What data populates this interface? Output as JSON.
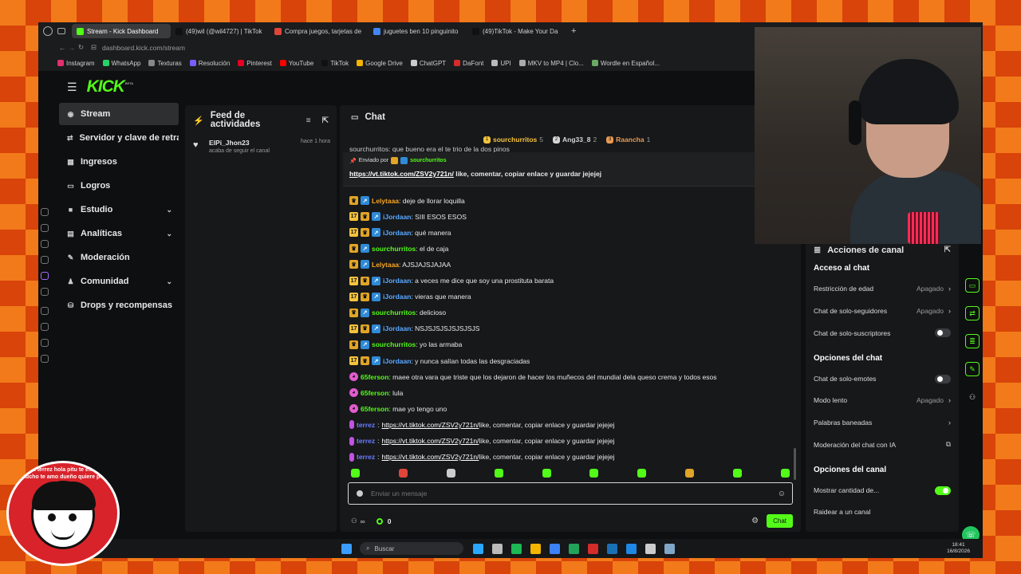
{
  "browser": {
    "tabs": [
      {
        "label": "Stream - Kick Dashboard",
        "active": true,
        "color": "#53fc18"
      },
      {
        "label": "(49)wil (@wil4727) | TikTok",
        "active": false,
        "color": "#111111"
      },
      {
        "label": "Compra juegos, tarjetas de",
        "active": false,
        "color": "#e0453a"
      },
      {
        "label": "juguetes ben 10 pinguinito",
        "active": false,
        "color": "#4285f4"
      },
      {
        "label": "(49)TikTok - Make Your Da",
        "active": false,
        "color": "#111111"
      }
    ],
    "new_tab": "+",
    "url": "dashboard.kick.com/stream",
    "bookmarks": [
      {
        "label": "Instagram",
        "color": "#e1306c"
      },
      {
        "label": "WhatsApp",
        "color": "#25d366"
      },
      {
        "label": "Texturas",
        "color": "#888888"
      },
      {
        "label": "Resolución",
        "color": "#7b5cff"
      },
      {
        "label": "Pinterest",
        "color": "#e60023"
      },
      {
        "label": "YouTube",
        "color": "#ff0000"
      },
      {
        "label": "TikTok",
        "color": "#111111"
      },
      {
        "label": "Google Drive",
        "color": "#f4b400"
      },
      {
        "label": "ChatGPT",
        "color": "#cccccc"
      },
      {
        "label": "DaFont",
        "color": "#d42b2b"
      },
      {
        "label": "UPI",
        "color": "#bbbbbb"
      },
      {
        "label": "MKV to MP4 | Clo...",
        "color": "#aaaaaa"
      },
      {
        "label": "Wordle en Español...",
        "color": "#6aaa64"
      }
    ]
  },
  "app": {
    "logo": "KICK",
    "logo_beta": "BETA",
    "nav": [
      {
        "label": "Stream",
        "icon": "stream-icon",
        "glyph": "((·))",
        "active": true,
        "expand": false
      },
      {
        "label": "Servidor y clave de retransmisión",
        "icon": "server-icon",
        "glyph": "⇄",
        "active": false,
        "expand": false
      },
      {
        "label": "Ingresos",
        "icon": "revenue-icon",
        "glyph": "▦",
        "active": false,
        "expand": false
      },
      {
        "label": "Logros",
        "icon": "achievements-icon",
        "glyph": "▭",
        "active": false,
        "expand": false
      },
      {
        "label": "Estudio",
        "icon": "studio-icon",
        "glyph": "■",
        "active": false,
        "expand": true
      },
      {
        "label": "Analíticas",
        "icon": "analytics-icon",
        "glyph": "▤",
        "active": false,
        "expand": true
      },
      {
        "label": "Moderación",
        "icon": "moderation-icon",
        "glyph": "✎",
        "active": false,
        "expand": false
      },
      {
        "label": "Comunidad",
        "icon": "community-icon",
        "glyph": "♟",
        "active": false,
        "expand": true
      },
      {
        "label": "Drops y recompensas",
        "icon": "drops-icon",
        "glyph": "⛁",
        "active": false,
        "expand": false
      }
    ],
    "feed": {
      "title": "Feed de actividades",
      "items": [
        {
          "user": "ElPi_Jhon23",
          "action": "acaba de seguir el canal",
          "time": "hace 1 hora"
        }
      ]
    },
    "chat": {
      "title": "Chat",
      "top_gifters": [
        {
          "rank": "1",
          "name": "sourchurritos",
          "count": "5",
          "color": "#f5c33b"
        },
        {
          "rank": "2",
          "name": "Ang33_8",
          "count": "2",
          "color": "#d6d6d6"
        },
        {
          "rank": "3",
          "name": "Raancha",
          "count": "1",
          "color": "#e89a53"
        }
      ],
      "pinned_partial": "sourchurritos: que bueno era el te trio de la dos pinos",
      "pinned": {
        "label": "Enviado por",
        "user": "sourchurritos",
        "link": "https://vt.tiktok.com/ZSV2y721n/",
        "text": " like, comentar, copiar enlace y guardar jejejej"
      },
      "messages": [
        {
          "badges": [
            "crown",
            "blue"
          ],
          "user": "Lelytaaa",
          "color": "#f5a623",
          "text": ": deje de llorar loquilla",
          "link": ""
        },
        {
          "badges": [
            "17",
            "crown",
            "blue"
          ],
          "user": "iJordaan",
          "color": "#5aa9ff",
          "text": ": SIII ESOS ESOS",
          "link": ""
        },
        {
          "badges": [
            "17",
            "crown",
            "blue"
          ],
          "user": "iJordaan",
          "color": "#5aa9ff",
          "text": ": qué manera",
          "link": ""
        },
        {
          "badges": [
            "crown",
            "blue"
          ],
          "user": "sourchurritos",
          "color": "#53fc18",
          "text": ": el de caja",
          "link": ""
        },
        {
          "badges": [
            "crown",
            "blue"
          ],
          "user": "Lelytaaa",
          "color": "#f5a623",
          "text": ": AJSJAJSJAJAA",
          "link": ""
        },
        {
          "badges": [
            "17",
            "crown",
            "blue"
          ],
          "user": "iJordaan",
          "color": "#5aa9ff",
          "text": ": a veces me dice que soy una prostituta barata",
          "link": ""
        },
        {
          "badges": [
            "17",
            "crown",
            "blue"
          ],
          "user": "iJordaan",
          "color": "#5aa9ff",
          "text": ": vieras que manera",
          "link": ""
        },
        {
          "badges": [
            "crown",
            "blue"
          ],
          "user": "sourchurritos",
          "color": "#53fc18",
          "text": ": delicioso",
          "link": ""
        },
        {
          "badges": [
            "17",
            "crown",
            "blue"
          ],
          "user": "iJordaan",
          "color": "#5aa9ff",
          "text": ": NSJSJSJSJSJSJSJS",
          "link": ""
        },
        {
          "badges": [
            "crown",
            "blue"
          ],
          "user": "sourchurritos",
          "color": "#53fc18",
          "text": ": yo las armaba",
          "link": ""
        },
        {
          "badges": [
            "17",
            "crown",
            "blue"
          ],
          "user": "iJordaan",
          "color": "#5aa9ff",
          "text": ": y nunca salían todas las desgraciadas",
          "link": ""
        },
        {
          "badges": [
            "pink"
          ],
          "user": "65ferson",
          "color": "#53fc18",
          "text": ": maee otra vara que triste que los dejaron de hacer los muñecos del mundial dela queso crema y todos esos",
          "link": ""
        },
        {
          "badges": [
            "pink"
          ],
          "user": "65ferson",
          "color": "#53fc18",
          "text": ": lula",
          "link": ""
        },
        {
          "badges": [
            "pink"
          ],
          "user": "65ferson",
          "color": "#53fc18",
          "text": ": mae yo tengo uno",
          "link": ""
        },
        {
          "badges": [
            "mic"
          ],
          "user": "terrez",
          "color": "#6a7dff",
          "text": " like, comentar, copiar enlace y guardar jejejej",
          "link": "https://vt.tiktok.com/ZSV2y721n/"
        },
        {
          "badges": [
            "mic"
          ],
          "user": "terrez",
          "color": "#6a7dff",
          "text": " like, comentar, copiar enlace y guardar jejejej",
          "link": "https://vt.tiktok.com/ZSV2y721n/"
        },
        {
          "badges": [
            "mic"
          ],
          "user": "terrez",
          "color": "#6a7dff",
          "text": " like, comentar, copiar enlace y guardar jejejej",
          "link": "https://vt.tiktok.com/ZSV2y721n/"
        }
      ],
      "emotes": [
        "#53fc18",
        "#e0453a",
        "#cccccc",
        "#53fc18",
        "#53fc18",
        "#53fc18",
        "#53fc18",
        "#e0a526",
        "#53fc18",
        "#53fc18"
      ],
      "input_placeholder": "Enviar un mensaje",
      "points": "0",
      "send_label": "Chat"
    },
    "actions": {
      "title": "Acciones de canal",
      "sections": [
        {
          "title": "Acceso al chat",
          "rows": [
            {
              "label": "Restricción de edad",
              "value": "Apagado",
              "kind": "arrow"
            },
            {
              "label": "Chat de solo-seguidores",
              "value": "Apagado",
              "kind": "arrow"
            },
            {
              "label": "Chat de solo-suscriptores",
              "value": "",
              "kind": "toggle-off"
            }
          ]
        },
        {
          "title": "Opciones del chat",
          "rows": [
            {
              "label": "Chat de solo-emotes",
              "value": "",
              "kind": "toggle-off"
            },
            {
              "label": "Modo lento",
              "value": "Apagado",
              "kind": "arrow"
            },
            {
              "label": "Palabras baneadas",
              "value": "",
              "kind": "arrow"
            },
            {
              "label": "Moderación del chat con IA",
              "value": "",
              "kind": "external"
            }
          ]
        },
        {
          "title": "Opciones del canal",
          "rows": [
            {
              "label": "Mostrar cantidad de...",
              "value": "",
              "kind": "toggle-on"
            },
            {
              "label": "Raidear a un canal",
              "value": "",
              "kind": "none"
            }
          ]
        }
      ]
    }
  },
  "taskbar": {
    "search": "Buscar",
    "time": "18:41",
    "date": "16/8/2026",
    "icons": [
      "#2aa7ff",
      "#bbbbbb",
      "#1db954",
      "#f4b400",
      "#3b82f6",
      "#22a35a",
      "#d42b2b",
      "#1b6fb5",
      "#1e88e5",
      "#cccccc",
      "#7fa6c9"
    ]
  },
  "overlay": {
    "sticker_text": "terrez terrez hola pitu te extraño mucho te amo dueño quiere por favor"
  },
  "colors": {
    "accent": "#53fc18",
    "panel": "#17181a",
    "background": "#0e0f10"
  }
}
